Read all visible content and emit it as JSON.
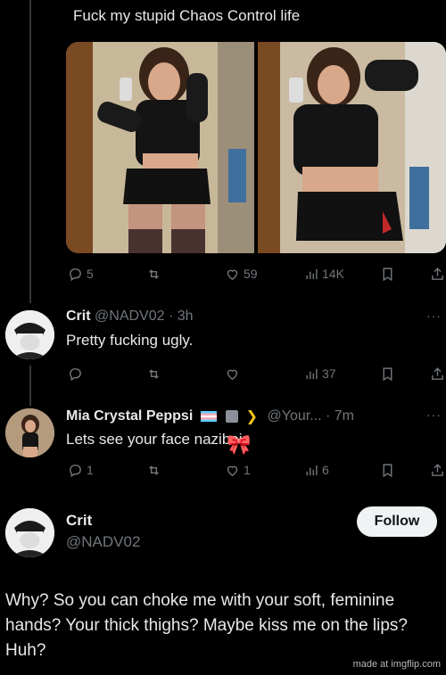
{
  "top_tweet": {
    "caption": "Fuck my stupid Chaos Control life",
    "actions": {
      "replies": "5",
      "retweets": "",
      "likes": "59",
      "views": "14K"
    }
  },
  "reply_1": {
    "name": "Crit",
    "handle": "@NADV02",
    "time": "· 3h",
    "text": "Pretty fucking ugly.",
    "actions": {
      "replies": "",
      "likes": "",
      "views": "37"
    }
  },
  "reply_2": {
    "name": "Mia Crystal Peppsi",
    "handle": "@Your...",
    "time": "· 7m",
    "text": "Lets see your face naziboi",
    "actions": {
      "replies": "1",
      "likes": "1",
      "views": "6"
    }
  },
  "focused_tweet": {
    "name": "Crit",
    "handle": "@NADV02",
    "follow_label": "Follow",
    "text": "Why? So you can choke me with your soft, feminine hands? Your thick thighs? Maybe kiss me on the lips? Huh?"
  },
  "watermark": "made at imgflip.com",
  "colors": {
    "background": "#000000",
    "muted": "#71767b",
    "text": "#e7e9ea"
  }
}
